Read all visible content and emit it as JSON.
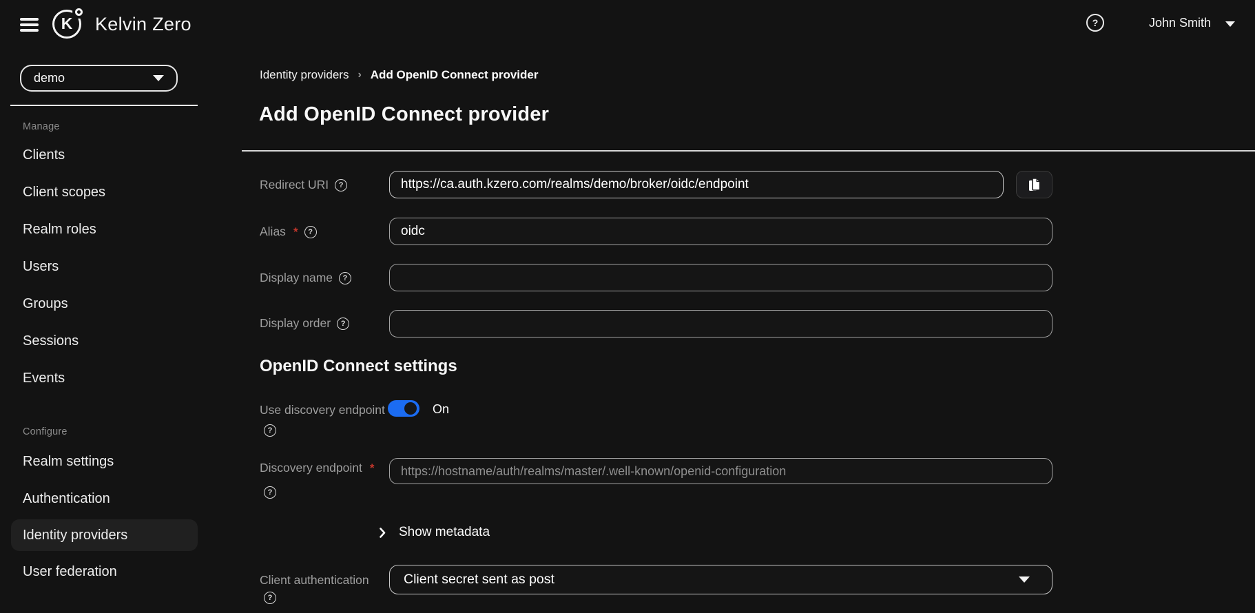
{
  "header": {
    "brand": "Kelvin Zero",
    "logo_letter": "K",
    "user_name": "John Smith",
    "help_glyph": "?"
  },
  "sidebar": {
    "realm_selector": {
      "value": "demo"
    },
    "sections": [
      {
        "label": "Manage",
        "items": [
          "Clients",
          "Client scopes",
          "Realm roles",
          "Users",
          "Groups",
          "Sessions",
          "Events"
        ]
      },
      {
        "label": "Configure",
        "items": [
          "Realm settings",
          "Authentication",
          "Identity providers",
          "User federation"
        ]
      }
    ],
    "active_item": "Identity providers"
  },
  "breadcrumb": {
    "parent": "Identity providers",
    "separator": "›",
    "current": "Add OpenID Connect provider"
  },
  "page": {
    "title": "Add OpenID Connect provider"
  },
  "form": {
    "help_glyph": "?",
    "required_marker": "*",
    "redirect_uri": {
      "label": "Redirect URI",
      "value": "https://ca.auth.kzero.com/realms/demo/broker/oidc/endpoint"
    },
    "alias": {
      "label": "Alias",
      "value": "oidc"
    },
    "display_name": {
      "label": "Display name",
      "value": ""
    },
    "display_order": {
      "label": "Display order",
      "value": ""
    },
    "section_heading": "OpenID Connect settings",
    "use_discovery_endpoint": {
      "label": "Use discovery endpoint",
      "state": "On"
    },
    "discovery_endpoint": {
      "label": "Discovery endpoint",
      "placeholder": "https://hostname/auth/realms/master/.well-known/openid-configuration"
    },
    "show_metadata_label": "Show metadata",
    "client_authentication": {
      "label": "Client authentication",
      "value": "Client secret sent as post"
    }
  },
  "colors": {
    "accent-blue": "#1b6cf2",
    "required-red": "#c5372c",
    "page-bg": "#131313",
    "highlight-bg": "#202020"
  }
}
